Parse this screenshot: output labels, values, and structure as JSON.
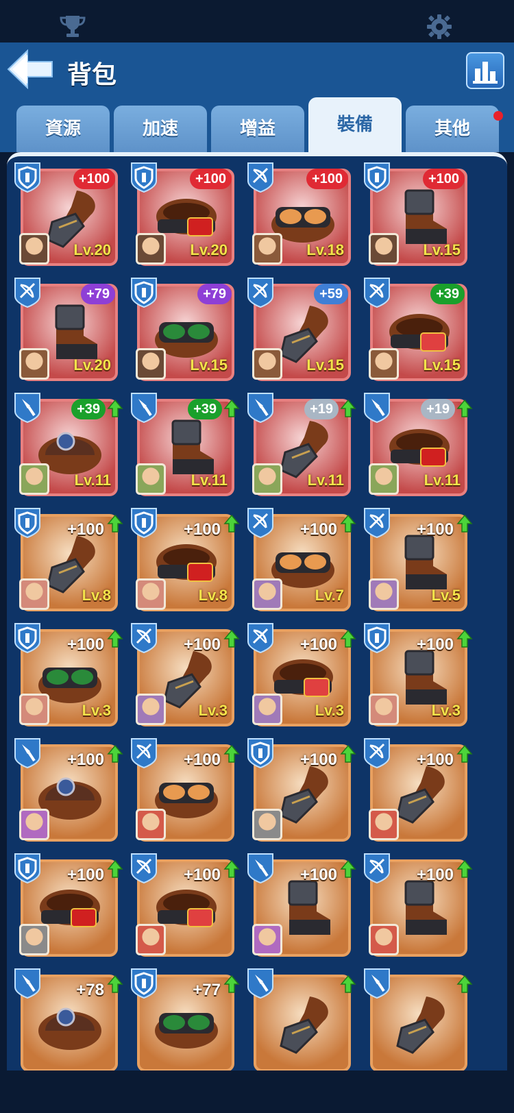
{
  "header": {
    "title": "背包"
  },
  "tabs": [
    {
      "label": "資源",
      "active": false,
      "notify": false
    },
    {
      "label": "加速",
      "active": false,
      "notify": false
    },
    {
      "label": "增益",
      "active": false,
      "notify": false
    },
    {
      "label": "裝備",
      "active": true,
      "notify": false
    },
    {
      "label": "其他",
      "active": false,
      "notify": true
    }
  ],
  "colors": {
    "header_bg": "#1a5594",
    "panel_bg": "#0e3467",
    "rarity_red": "#c44a4a",
    "rarity_orange": "#c9783a",
    "bonus_red": "#e02a34",
    "bonus_purple": "#8e3fd6",
    "bonus_blue": "#3f7fd6",
    "bonus_green": "#1aa02b",
    "bonus_gray": "#a9b6c4",
    "level_yellow": "#f2e34a",
    "upgrade_green": "#4cd43a"
  },
  "items": [
    {
      "cls": "shield",
      "bonus": "+100",
      "badge": "red",
      "lv": "Lv.20",
      "rarity": "red",
      "piece": "gauntlet",
      "hero": "h1",
      "up": false
    },
    {
      "cls": "shield",
      "bonus": "+100",
      "badge": "red",
      "lv": "Lv.20",
      "rarity": "red",
      "piece": "belt",
      "hero": "h1",
      "up": false
    },
    {
      "cls": "bow",
      "bonus": "+100",
      "badge": "red",
      "lv": "Lv.18",
      "rarity": "red",
      "piece": "goggles",
      "hero": "h2",
      "up": false
    },
    {
      "cls": "shield",
      "bonus": "+100",
      "badge": "red",
      "lv": "Lv.15",
      "rarity": "red",
      "piece": "boot",
      "hero": "h1",
      "up": false
    },
    {
      "cls": "bow",
      "bonus": "+79",
      "badge": "purple",
      "lv": "Lv.20",
      "rarity": "red",
      "piece": "boot",
      "hero": "h2",
      "up": false
    },
    {
      "cls": "shield",
      "bonus": "+79",
      "badge": "purple",
      "lv": "Lv.15",
      "rarity": "red",
      "piece": "goggles-green",
      "hero": "h1",
      "up": false
    },
    {
      "cls": "bow",
      "bonus": "+59",
      "badge": "blue",
      "lv": "Lv.15",
      "rarity": "red",
      "piece": "gauntlet",
      "hero": "h2",
      "up": false
    },
    {
      "cls": "bow",
      "bonus": "+39",
      "badge": "green",
      "lv": "Lv.15",
      "rarity": "red",
      "piece": "belt-red",
      "hero": "h2",
      "up": false
    },
    {
      "cls": "dagger",
      "bonus": "+39",
      "badge": "green",
      "lv": "Lv.11",
      "rarity": "red",
      "piece": "helmet",
      "hero": "h3",
      "up": true
    },
    {
      "cls": "dagger",
      "bonus": "+39",
      "badge": "green",
      "lv": "Lv.11",
      "rarity": "red",
      "piece": "boot",
      "hero": "h3",
      "up": true
    },
    {
      "cls": "dagger",
      "bonus": "+19",
      "badge": "gray",
      "lv": "Lv.11",
      "rarity": "red",
      "piece": "gauntlet",
      "hero": "h3",
      "up": true
    },
    {
      "cls": "dagger",
      "bonus": "+19",
      "badge": "gray",
      "lv": "Lv.11",
      "rarity": "red",
      "piece": "belt",
      "hero": "h3",
      "up": true
    },
    {
      "cls": "shield",
      "bonus": "+100",
      "badge": "plain",
      "lv": "Lv.8",
      "rarity": "orange",
      "piece": "gauntlet",
      "hero": "h4",
      "up": true
    },
    {
      "cls": "shield",
      "bonus": "+100",
      "badge": "plain",
      "lv": "Lv.8",
      "rarity": "orange",
      "piece": "belt",
      "hero": "h4",
      "up": true
    },
    {
      "cls": "bow",
      "bonus": "+100",
      "badge": "plain",
      "lv": "Lv.7",
      "rarity": "orange",
      "piece": "goggles",
      "hero": "h5",
      "up": true
    },
    {
      "cls": "bow",
      "bonus": "+100",
      "badge": "plain",
      "lv": "Lv.5",
      "rarity": "orange",
      "piece": "boot",
      "hero": "h5",
      "up": true
    },
    {
      "cls": "shield",
      "bonus": "+100",
      "badge": "plain",
      "lv": "Lv.3",
      "rarity": "orange",
      "piece": "goggles-green",
      "hero": "h4",
      "up": true
    },
    {
      "cls": "bow",
      "bonus": "+100",
      "badge": "plain",
      "lv": "Lv.3",
      "rarity": "orange",
      "piece": "gauntlet",
      "hero": "h5",
      "up": true
    },
    {
      "cls": "bow",
      "bonus": "+100",
      "badge": "plain",
      "lv": "Lv.3",
      "rarity": "orange",
      "piece": "belt-red",
      "hero": "h5",
      "up": true
    },
    {
      "cls": "shield",
      "bonus": "+100",
      "badge": "plain",
      "lv": "Lv.3",
      "rarity": "orange",
      "piece": "boot",
      "hero": "h4",
      "up": true
    },
    {
      "cls": "dagger",
      "bonus": "+100",
      "badge": "plain",
      "lv": "",
      "rarity": "orange",
      "piece": "helmet",
      "hero": "h6",
      "up": true
    },
    {
      "cls": "bow",
      "bonus": "+100",
      "badge": "plain",
      "lv": "",
      "rarity": "orange",
      "piece": "goggles",
      "hero": "h7",
      "up": true
    },
    {
      "cls": "shield",
      "bonus": "+100",
      "badge": "plain",
      "lv": "",
      "rarity": "orange",
      "piece": "gauntlet",
      "hero": "h8",
      "up": true
    },
    {
      "cls": "bow",
      "bonus": "+100",
      "badge": "plain",
      "lv": "",
      "rarity": "orange",
      "piece": "gauntlet",
      "hero": "h7",
      "up": true
    },
    {
      "cls": "shield",
      "bonus": "+100",
      "badge": "plain",
      "lv": "",
      "rarity": "orange",
      "piece": "belt",
      "hero": "h8",
      "up": true
    },
    {
      "cls": "bow",
      "bonus": "+100",
      "badge": "plain",
      "lv": "",
      "rarity": "orange",
      "piece": "belt-red",
      "hero": "h7",
      "up": true
    },
    {
      "cls": "dagger",
      "bonus": "+100",
      "badge": "plain",
      "lv": "",
      "rarity": "orange",
      "piece": "boot",
      "hero": "h6",
      "up": true
    },
    {
      "cls": "bow",
      "bonus": "+100",
      "badge": "plain",
      "lv": "",
      "rarity": "orange",
      "piece": "boot",
      "hero": "h7",
      "up": true
    },
    {
      "cls": "dagger",
      "bonus": "+78",
      "badge": "plain",
      "lv": "",
      "rarity": "orange",
      "piece": "helmet",
      "hero": "",
      "up": true
    },
    {
      "cls": "shield",
      "bonus": "+77",
      "badge": "plain",
      "lv": "",
      "rarity": "orange",
      "piece": "goggles-green",
      "hero": "",
      "up": true
    },
    {
      "cls": "dagger",
      "bonus": "",
      "badge": "plain",
      "lv": "",
      "rarity": "orange",
      "piece": "gauntlet",
      "hero": "",
      "up": true
    },
    {
      "cls": "dagger",
      "bonus": "",
      "badge": "plain",
      "lv": "",
      "rarity": "orange",
      "piece": "gauntlet",
      "hero": "",
      "up": true
    }
  ]
}
